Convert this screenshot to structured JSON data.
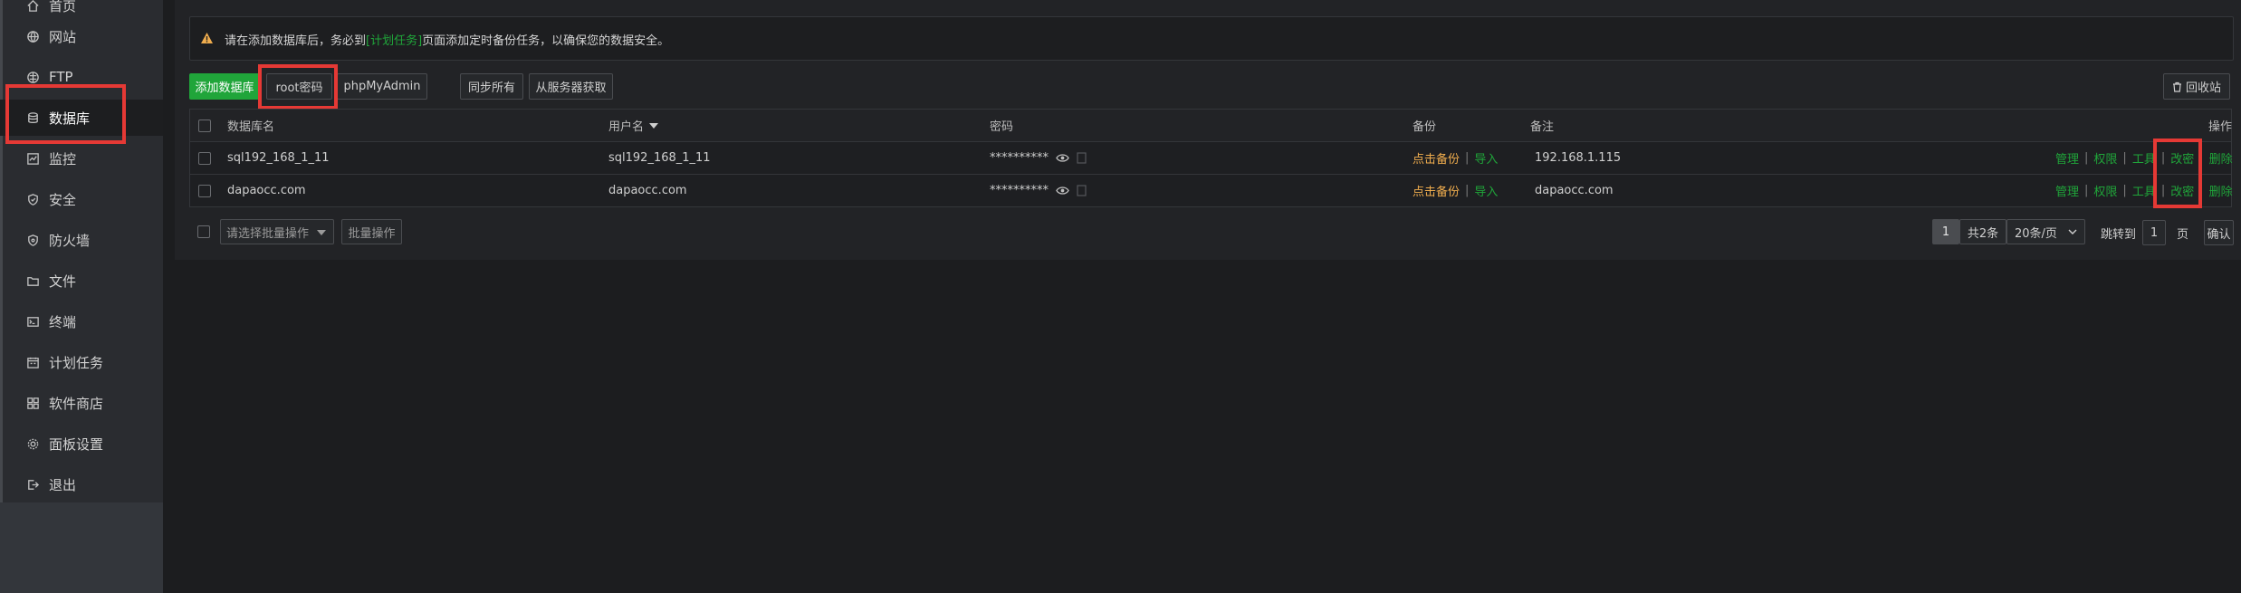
{
  "sidebar": {
    "items": [
      {
        "label": "首页",
        "icon": "home-icon"
      },
      {
        "label": "网站",
        "icon": "globe-icon"
      },
      {
        "label": "FTP",
        "icon": "ftp-icon"
      },
      {
        "label": "数据库",
        "icon": "database-icon",
        "active": true
      },
      {
        "label": "监控",
        "icon": "monitor-icon"
      },
      {
        "label": "安全",
        "icon": "shield-icon"
      },
      {
        "label": "防火墙",
        "icon": "firewall-icon"
      },
      {
        "label": "文件",
        "icon": "folder-icon"
      },
      {
        "label": "终端",
        "icon": "terminal-icon"
      },
      {
        "label": "计划任务",
        "icon": "schedule-icon"
      },
      {
        "label": "软件商店",
        "icon": "app-store-icon"
      },
      {
        "label": "面板设置",
        "icon": "gear-icon"
      },
      {
        "label": "退出",
        "icon": "logout-icon"
      }
    ]
  },
  "notice": {
    "before": "请在添加数据库后，务必到",
    "link": "[计划任务]",
    "after": "页面添加定时备份任务，以确保您的数据安全。"
  },
  "toolbar": {
    "add_db": "添加数据库",
    "root_pwd": "root密码",
    "phpmyadmin": "phpMyAdmin",
    "sync_all": "同步所有",
    "fetch_from_server": "从服务器获取",
    "recycle": "回收站"
  },
  "table": {
    "headers": {
      "name": "数据库名",
      "user": "用户名",
      "password": "密码",
      "backup": "备份",
      "note": "备注",
      "ops": "操作"
    },
    "rows": [
      {
        "name": "sql192_168_1_11",
        "user": "sql192_168_1_11",
        "password": "**********",
        "backup": "点击备份",
        "import": "导入",
        "note": "192.168.1.115"
      },
      {
        "name": "dapaocc.com",
        "user": "dapaocc.com",
        "password": "**********",
        "backup": "点击备份",
        "import": "导入",
        "note": "dapaocc.com"
      }
    ],
    "actions": {
      "manage": "管理",
      "perm": "权限",
      "tools": "工具",
      "change_pwd": "改密",
      "delete": "删除"
    }
  },
  "footer": {
    "batch_placeholder": "请选择批量操作",
    "batch_btn": "批量操作",
    "page": "1",
    "total": "共2条",
    "per_page": "20条/页",
    "jump_label": "跳转到",
    "jump_value": "1",
    "page_unit": "页",
    "confirm": "确认"
  },
  "colors": {
    "accent": "#20a53a",
    "backup_link": "#f0ad4e",
    "highlight": "#e53935"
  }
}
